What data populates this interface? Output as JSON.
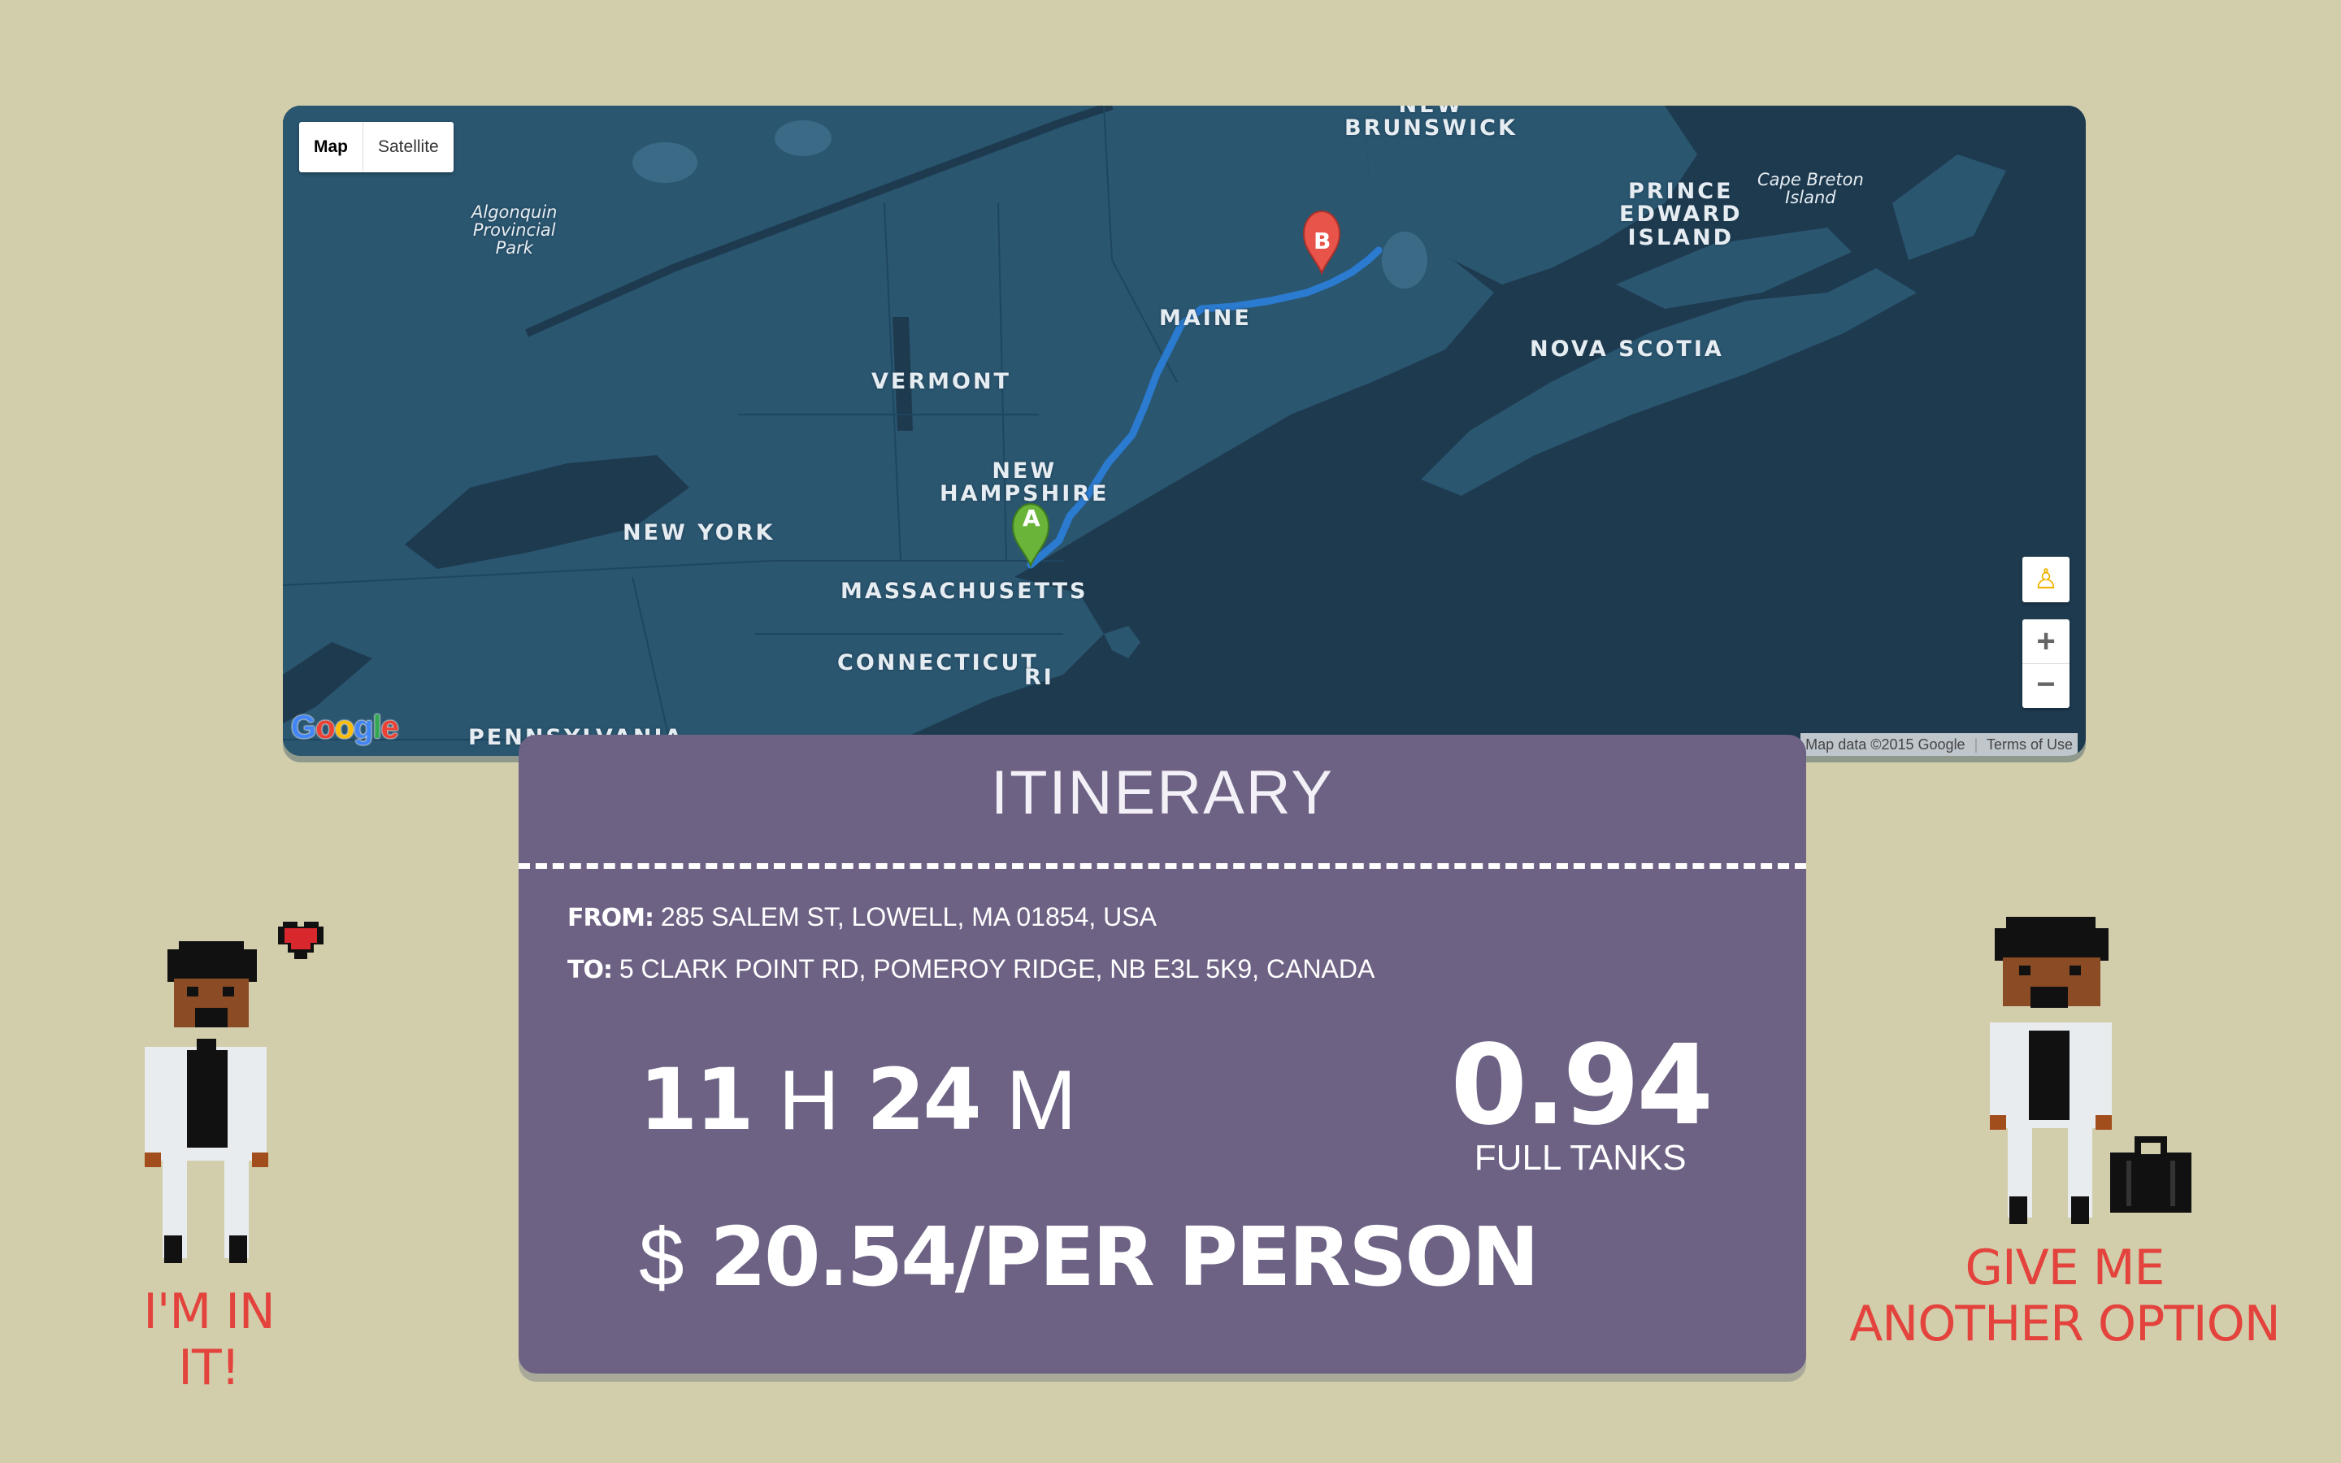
{
  "map": {
    "type_controls": [
      "Map",
      "Satellite"
    ],
    "labels": {
      "new_brunswick": "NEW\nBRUNSWICK",
      "prince_edward_island": "PRINCE\nEDWARD\nISLAND",
      "cape_breton_island": "Cape Breton\nIsland",
      "algonquin": "Algonquin\nProvincial\nPark",
      "maine": "MAINE",
      "vermont": "VERMONT",
      "nova_scotia": "NOVA SCOTIA",
      "new_hampshire": "NEW\nHAMPSHIRE",
      "new_york": "NEW YORK",
      "massachusetts": "MASSACHUSETTS",
      "connecticut": "CONNECTICUT",
      "ri": "RI",
      "pennsylvania": "PENNSYLVANIA"
    },
    "marker_a": "A",
    "marker_b": "B",
    "attribution": "Map data ©2015 Google",
    "terms": "Terms of Use",
    "google": "Google",
    "zoom_in": "+",
    "zoom_out": "−",
    "colors": {
      "water": "#1e3a4f",
      "land": "#2a5670",
      "route": "#2b7bd0"
    }
  },
  "itinerary": {
    "title": "ITINERARY",
    "from_label": "FROM:",
    "from_value": "285 SALEM ST, LOWELL, MA 01854, USA",
    "to_label": "TO:",
    "to_value": "5 CLARK POINT RD, POMEROY RIDGE, NB E3L 5K9, CANADA",
    "hours": "11",
    "hours_unit": "H",
    "minutes": "24",
    "minutes_unit": "M",
    "tanks_value": "0.94",
    "tanks_label": "FULL TANKS",
    "currency": "$",
    "cost": "20.54/PER PERSON"
  },
  "actions": {
    "accept": "I'M IN IT!",
    "another_line1": "GIVE ME",
    "another_line2": "ANOTHER OPTION"
  }
}
